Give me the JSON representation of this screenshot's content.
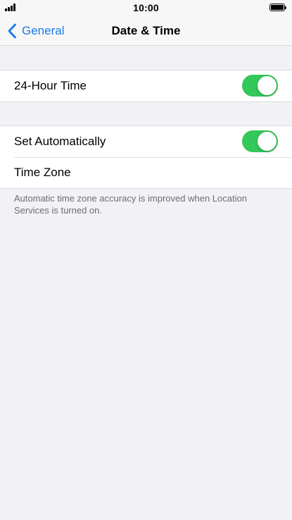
{
  "status_bar": {
    "time": "10:00",
    "signal_icon": "signal-bars-icon",
    "battery_icon": "battery-icon"
  },
  "nav": {
    "back_label": "General",
    "title": "Date & Time",
    "back_icon": "chevron-left-icon",
    "accent_color": "#1a7ae6"
  },
  "settings": {
    "hour24": {
      "label": "24-Hour Time",
      "enabled": true
    },
    "set_automatically": {
      "label": "Set Automatically",
      "enabled": true
    },
    "time_zone": {
      "label": "Time Zone"
    },
    "footer": "Automatic time zone accuracy is improved when Location Services is turned on."
  },
  "colors": {
    "toggle_on": "#34c759",
    "background": "#f1f1f6"
  }
}
